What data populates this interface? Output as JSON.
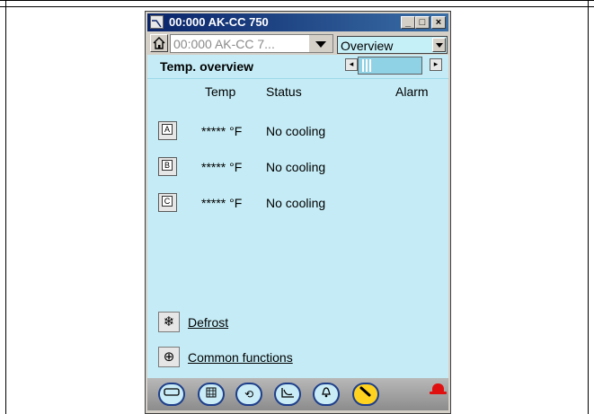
{
  "window": {
    "title": "00:000 AK-CC 750",
    "controls": {
      "minimize": "_",
      "maximize": "□",
      "close": "×"
    }
  },
  "nav": {
    "device_value": "00:000 AK-CC 7...",
    "view_value": "Overview"
  },
  "panel": {
    "title": "Temp. overview",
    "columns": {
      "temp": "Temp",
      "status": "Status",
      "alarm": "Alarm"
    },
    "sections": [
      {
        "letter": "A",
        "temp": "***** °F",
        "status": "No cooling"
      },
      {
        "letter": "B",
        "temp": "***** °F",
        "status": "No cooling"
      },
      {
        "letter": "C",
        "temp": "***** °F",
        "status": "No cooling"
      }
    ],
    "links": [
      {
        "label": "Defrost",
        "icon": "snowflake-icon"
      },
      {
        "label": "Common functions",
        "icon": "crosshair-icon"
      }
    ]
  },
  "bottom_nav": {
    "buttons": [
      {
        "icon": "device-icon",
        "active": false
      },
      {
        "icon": "grid-icon",
        "active": false
      },
      {
        "icon": "cycle-icon",
        "active": false
      },
      {
        "icon": "graph-icon",
        "active": false
      },
      {
        "icon": "bell-icon",
        "active": false
      },
      {
        "icon": "wrench-icon",
        "active": true
      }
    ],
    "alarm_indicator": "alarm-bell-icon"
  },
  "colors": {
    "title_bar_start": "#0a246a",
    "title_bar_end": "#3a6ea5",
    "panel_bg": "#c5ecf6",
    "active_nav": "#ffd21f",
    "alarm": "#e01010"
  }
}
